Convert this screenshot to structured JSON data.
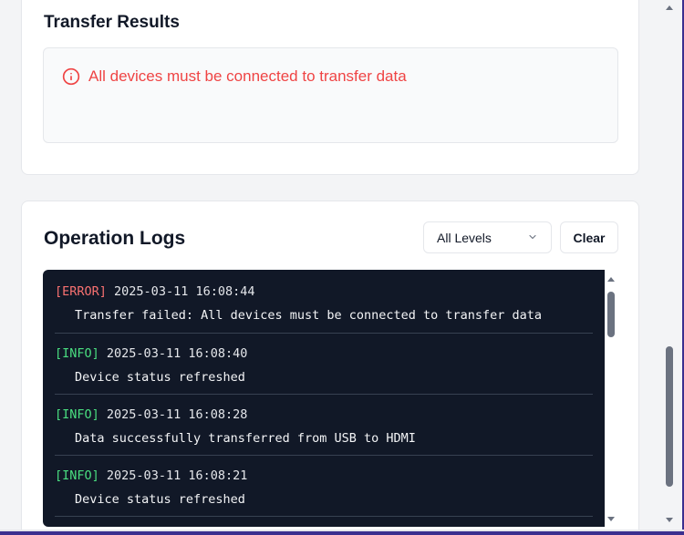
{
  "transfer_results": {
    "title": "Transfer Results",
    "error_message": "All devices must be connected to transfer data"
  },
  "operation_logs": {
    "title": "Operation Logs",
    "level_filter": {
      "selected": "All Levels"
    },
    "clear_label": "Clear",
    "entries": [
      {
        "level": "[ERROR]",
        "timestamp": "2025-03-11 16:08:44",
        "message": "Transfer failed: All devices must be connected to transfer data"
      },
      {
        "level": "[INFO]",
        "timestamp": "2025-03-11 16:08:40",
        "message": "Device status refreshed"
      },
      {
        "level": "[INFO]",
        "timestamp": "2025-03-11 16:08:28",
        "message": "Data successfully transferred from USB to HDMI"
      },
      {
        "level": "[INFO]",
        "timestamp": "2025-03-11 16:08:21",
        "message": "Device status refreshed"
      }
    ]
  },
  "colors": {
    "error": "#ef4444",
    "info": "#4ade80",
    "console_bg": "#111827"
  },
  "icons": {
    "error_icon": "info-circle-icon",
    "select_chevron": "chevron-down-icon"
  }
}
